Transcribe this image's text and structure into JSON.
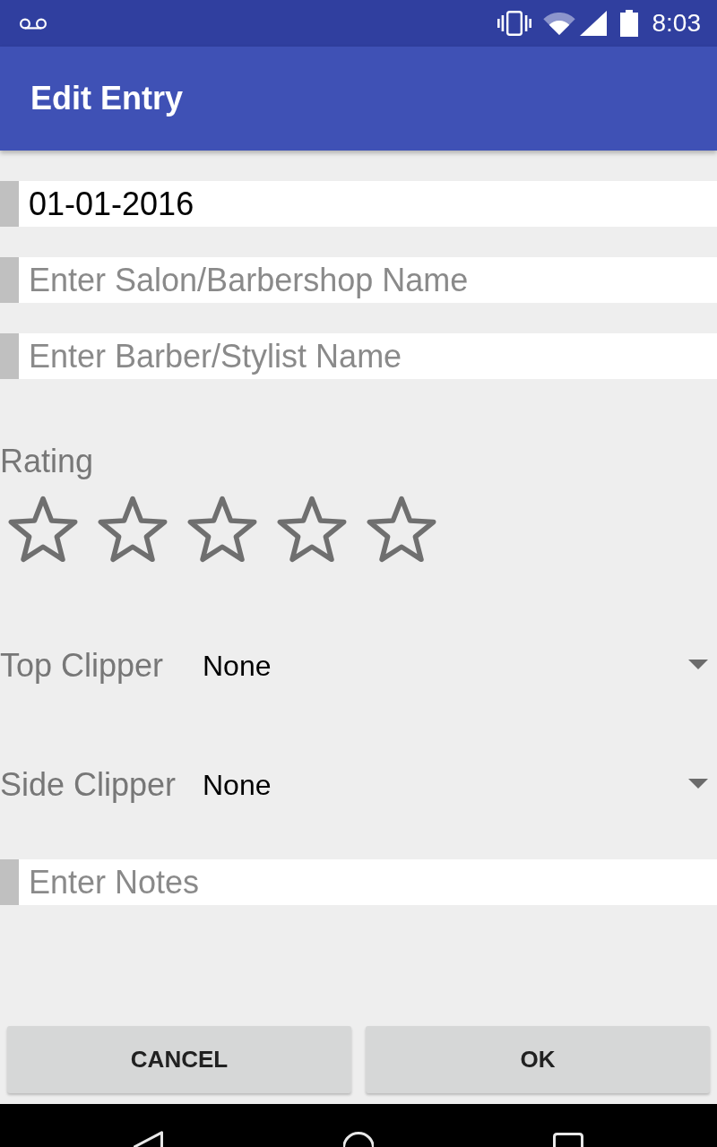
{
  "status_bar": {
    "time": "8:03"
  },
  "app_bar": {
    "title": "Edit Entry"
  },
  "form": [
    {
      "kind": "input",
      "value": "01-01-2016"
    },
    {
      "kind": "input",
      "placeholder": "Enter Salon/Barbershop Name"
    },
    {
      "kind": "input",
      "placeholder": "Enter Barber/Stylist Name"
    },
    {
      "kind": "rating",
      "label": "Rating",
      "stars": 0
    },
    {
      "kind": "dropdown",
      "label": "Top Clipper",
      "value": "None"
    },
    {
      "kind": "dropdown",
      "label": "Side Clipper",
      "value": "None"
    },
    {
      "kind": "input",
      "placeholder": "Enter Notes"
    }
  ],
  "buttons": [
    {
      "label": "CANCEL"
    },
    {
      "label": "OK"
    }
  ]
}
